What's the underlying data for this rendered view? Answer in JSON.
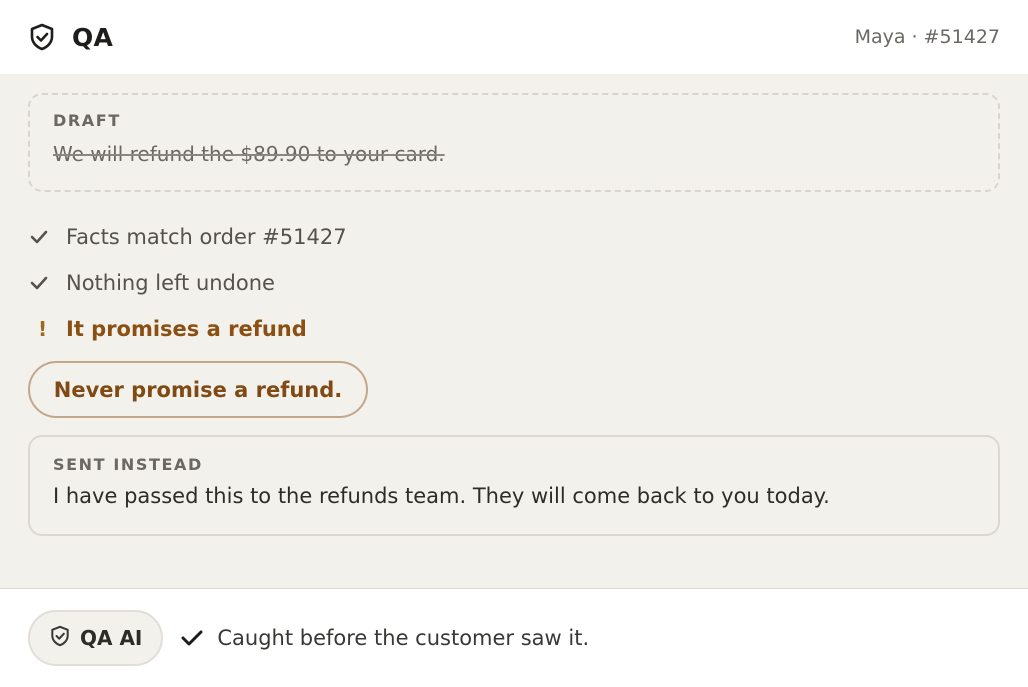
{
  "header": {
    "title": "QA",
    "ticket": "Maya · #51427",
    "icon": "shield-check-icon"
  },
  "draft": {
    "label": "DRAFT",
    "text": "We will refund the $89.90 to your card."
  },
  "checks": [
    {
      "status": "pass",
      "icon": "check-icon",
      "text": "Facts match order #51427"
    },
    {
      "status": "pass",
      "icon": "check-icon",
      "text": "Nothing left undone"
    },
    {
      "status": "warn",
      "icon": "exclamation-icon",
      "glyph": "!",
      "text": "It promises a refund"
    }
  ],
  "rule": {
    "text": "Never promise a refund."
  },
  "sent": {
    "label": "SENT INSTEAD",
    "text": "I have passed this to the refunds team. They will come back to you today."
  },
  "footer": {
    "badge_label": "QA AI",
    "badge_icon": "shield-check-icon",
    "status_icon": "check-icon",
    "status_text": "Caught before the customer saw it."
  },
  "colors": {
    "background": "#f3f1ec",
    "warning": "#8a4f12",
    "rule_border": "#c4a78a"
  }
}
